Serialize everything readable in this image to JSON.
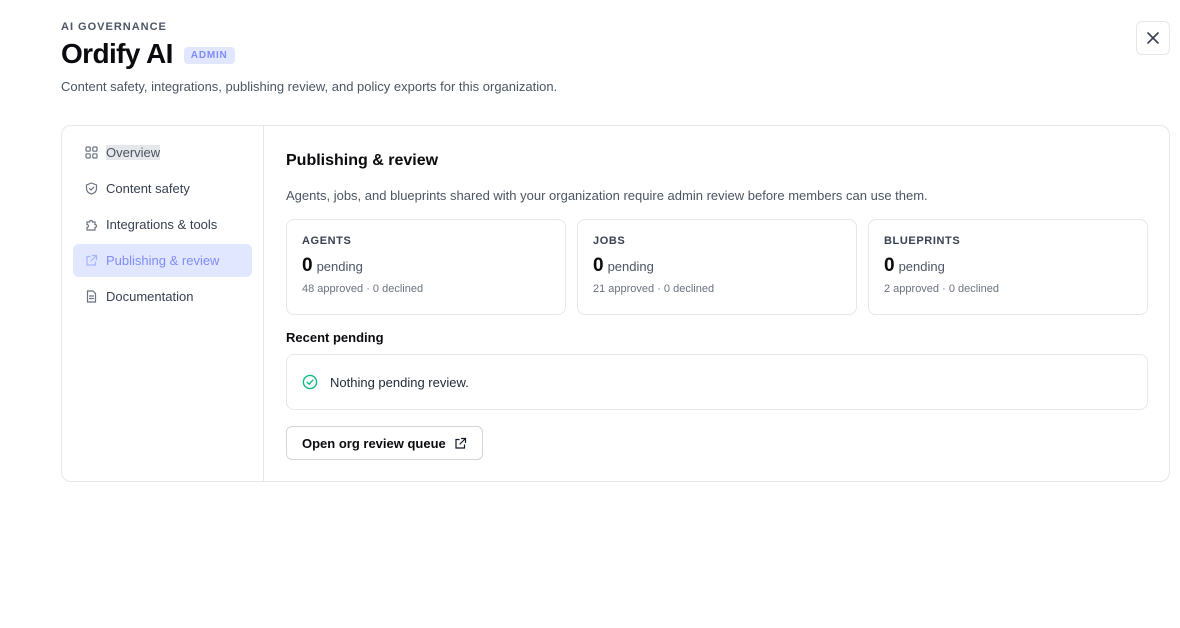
{
  "header": {
    "eyebrow": "AI GOVERNANCE",
    "title": "Ordify AI",
    "badge": "ADMIN",
    "subtitle": "Content safety, integrations, publishing review, and policy exports for this organization."
  },
  "sidebar": {
    "items": [
      {
        "label": "Overview",
        "icon": "grid-icon"
      },
      {
        "label": "Content safety",
        "icon": "shield-icon"
      },
      {
        "label": "Integrations & tools",
        "icon": "puzzle-icon"
      },
      {
        "label": "Publishing & review",
        "icon": "share-icon"
      },
      {
        "label": "Documentation",
        "icon": "document-icon"
      }
    ]
  },
  "main": {
    "title": "Publishing & review",
    "description": "Agents, jobs, and blueprints shared with your organization require admin review before members can use them.",
    "cards": [
      {
        "label": "AGENTS",
        "count": "0",
        "unit": "pending",
        "meta": "48 approved · 0 declined"
      },
      {
        "label": "JOBS",
        "count": "0",
        "unit": "pending",
        "meta": "21 approved · 0 declined"
      },
      {
        "label": "BLUEPRINTS",
        "count": "0",
        "unit": "pending",
        "meta": "2 approved · 0 declined"
      }
    ],
    "recent_title": "Recent pending",
    "empty_message": "Nothing pending review.",
    "queue_button": "Open org review queue"
  },
  "colors": {
    "accent": "#818cf8",
    "accent_bg": "#e0e7ff",
    "success": "#10b981",
    "border": "#e5e7eb"
  }
}
